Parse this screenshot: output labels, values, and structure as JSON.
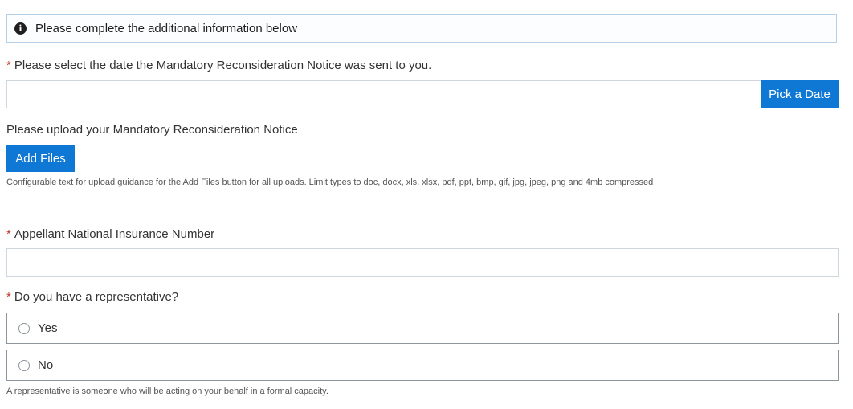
{
  "banner": {
    "icon": "info-icon",
    "icon_glyph": "i",
    "text": "Please complete the additional information below"
  },
  "required_marker": "*",
  "date_field": {
    "label": "Please select the date the Mandatory Reconsideration Notice was sent to you.",
    "value": "",
    "button_label": "Pick a Date"
  },
  "upload": {
    "label": "Please upload your Mandatory Reconsideration Notice",
    "button_label": "Add Files",
    "guidance": "Configurable text for upload guidance for the Add Files button for all uploads. Limit types to doc, docx, xls, xlsx, pdf, ppt, bmp, gif, jpg, jpeg, png and 4mb compressed"
  },
  "nino_field": {
    "label": "Appellant National Insurance Number",
    "value": ""
  },
  "representative": {
    "label": "Do you have a representative?",
    "options": [
      {
        "label": "Yes",
        "selected": false
      },
      {
        "label": "No",
        "selected": false
      }
    ],
    "hint": "A representative is someone who will be acting on your behalf in a formal capacity."
  },
  "colors": {
    "accent": "#0f78d4",
    "required": "#c0392b",
    "banner_border": "#b5cfe6"
  }
}
